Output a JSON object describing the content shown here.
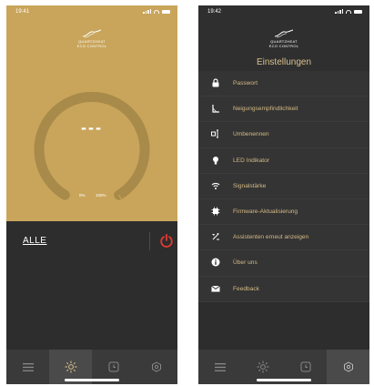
{
  "screen1": {
    "status_time": "19:41",
    "logo_line1": "QUARTZHEAT",
    "logo_line2": "ECO CONTROL",
    "gauge_value": "---",
    "gauge_min_label": "0%",
    "gauge_max_label": "100%",
    "device_group": "ALLE",
    "colors": {
      "gold": "#c9a55b",
      "power_red": "#e43a30"
    }
  },
  "screen2": {
    "status_time": "19:42",
    "logo_line1": "QUARTZHEAT",
    "logo_line2": "ECO CONTROL",
    "title": "Einstellungen",
    "menu": [
      {
        "label": "Passwort",
        "icon": "lock-icon"
      },
      {
        "label": "Neigungsempfindlichkeit",
        "icon": "tilt-icon"
      },
      {
        "label": "Umbenennen",
        "icon": "rename-icon"
      },
      {
        "label": "LED Indikator",
        "icon": "bulb-icon"
      },
      {
        "label": "Signalstärke",
        "icon": "wifi-icon"
      },
      {
        "label": "Firmware-Aktualisierung",
        "icon": "chip-icon"
      },
      {
        "label": "Assistenten erneut anzeigen",
        "icon": "assistant-icon"
      },
      {
        "label": "Über uns",
        "icon": "info-icon"
      },
      {
        "label": "Feedback",
        "icon": "mail-icon"
      }
    ]
  },
  "tabs": [
    {
      "icon": "menu-icon"
    },
    {
      "icon": "sun-icon"
    },
    {
      "icon": "clock-icon"
    },
    {
      "icon": "settings-hex-icon"
    }
  ]
}
